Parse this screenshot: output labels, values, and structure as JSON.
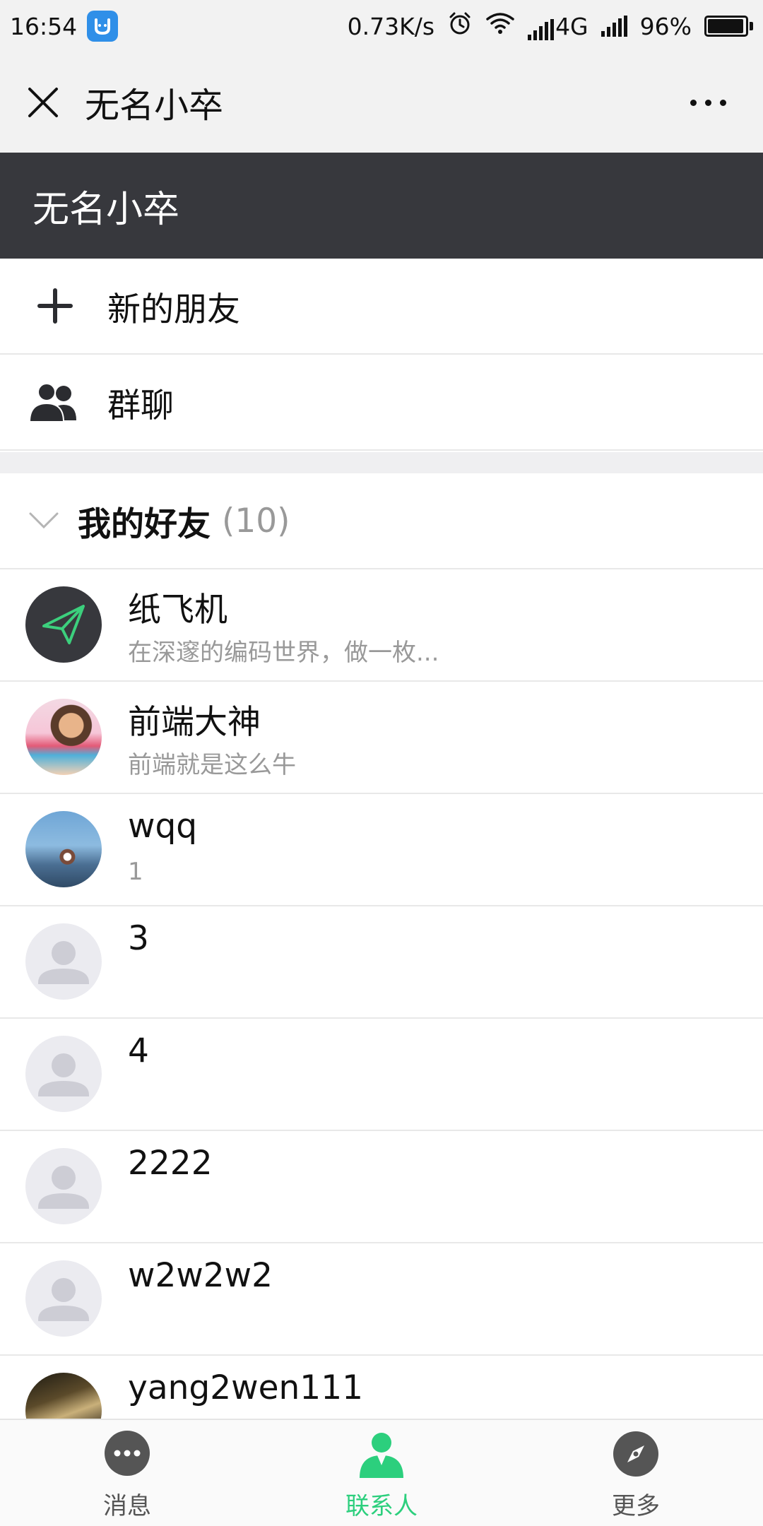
{
  "status_bar": {
    "time": "16:54",
    "network_speed": "0.73K/s",
    "network_type": "4G",
    "battery": "96%",
    "battery_level": 0.96
  },
  "title_bar": {
    "title": "无名小卒"
  },
  "profile_bar": {
    "name": "无名小卒"
  },
  "actions": [
    {
      "label": "新的朋友",
      "icon": "plus-icon"
    },
    {
      "label": "群聊",
      "icon": "group-icon"
    }
  ],
  "group": {
    "title": "我的好友",
    "count": "(10)"
  },
  "friends": [
    {
      "name": "纸飞机",
      "signature": "在深邃的编码世界，做一枚...",
      "avatar": "paper-plane"
    },
    {
      "name": "前端大神",
      "signature": "前端就是这么牛",
      "avatar": "photo-portrait"
    },
    {
      "name": "wqq",
      "signature": "1",
      "avatar": "photo-scene"
    },
    {
      "name": "3",
      "signature": "",
      "avatar": "default"
    },
    {
      "name": "4",
      "signature": "",
      "avatar": "default"
    },
    {
      "name": "2222",
      "signature": "",
      "avatar": "default"
    },
    {
      "name": "w2w2w2",
      "signature": "",
      "avatar": "default"
    },
    {
      "name": "yang2wen111",
      "signature": "",
      "avatar": "photo-dark"
    }
  ],
  "tabs": [
    {
      "label": "消息",
      "icon": "chat-bubble-icon",
      "active": false
    },
    {
      "label": "联系人",
      "icon": "contact-person-icon",
      "active": true
    },
    {
      "label": "更多",
      "icon": "compass-icon",
      "active": false
    }
  ],
  "colors": {
    "accent": "#2ccf7d",
    "dark_header": "#37383d",
    "secondary_text": "#999999",
    "default_avatar_bg": "#e8e8ee"
  }
}
